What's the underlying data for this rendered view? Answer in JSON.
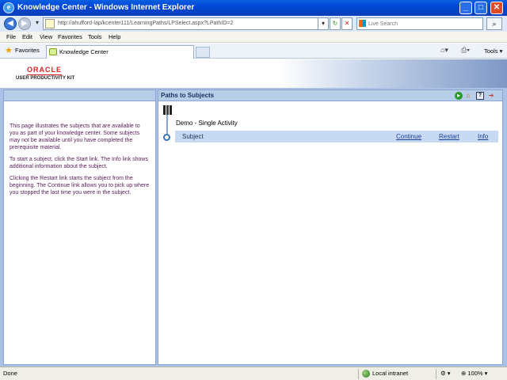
{
  "window": {
    "title": "Knowledge Center - Windows Internet Explorer",
    "minimize": "_",
    "maximize": "□",
    "close": "✕"
  },
  "address": {
    "url": "http://ahufford-lap/kcenter111/LearningPaths/LPSelect.aspx?LPathID=2",
    "search_placeholder": "Live Search"
  },
  "menu": [
    "File",
    "Edit",
    "View",
    "Favorites",
    "Tools",
    "Help"
  ],
  "favbar": {
    "favorites": "Favorites",
    "tab_label": "Knowledge Center",
    "tools": "Tools"
  },
  "banner": {
    "brand": "ORACLE",
    "product": "USER PRODUCTIVITY KIT"
  },
  "left_panel": {
    "paragraphs": [
      "This page illustrates the subjects that are available to you as part of your knowledge center. Some subjects may not be available until you have completed the prerequisite material.",
      "To start a subject, click the Start link. The Info link shows additional information about the subject.",
      "Clicking the Restart link starts the subject from the beginning. The Continue link allows you to pick up where you stopped the last time you were in the subject."
    ]
  },
  "right_panel": {
    "title": "Paths to Subjects",
    "path_name": "Demo - Single Activity",
    "subject": {
      "name": "Subject",
      "continue": "Continue",
      "restart": "Restart",
      "info": "Info"
    }
  },
  "status": {
    "left": "Done",
    "zone": "Local intranet",
    "zoom": "100%"
  },
  "icons": [
    "ie-icon",
    "back-icon",
    "forward-icon",
    "refresh-icon",
    "stop-icon",
    "search-icon",
    "star-icon",
    "home-icon",
    "print-icon",
    "book-icon",
    "start-icon",
    "help-icon",
    "exit-icon",
    "globe-icon"
  ],
  "colors": {
    "title_bar": "#0046d5",
    "panel_header": "#b8cde8",
    "instruction_text": "#5a1a5a",
    "link": "#1a3f9e",
    "brand_red": "#e01e1e"
  }
}
